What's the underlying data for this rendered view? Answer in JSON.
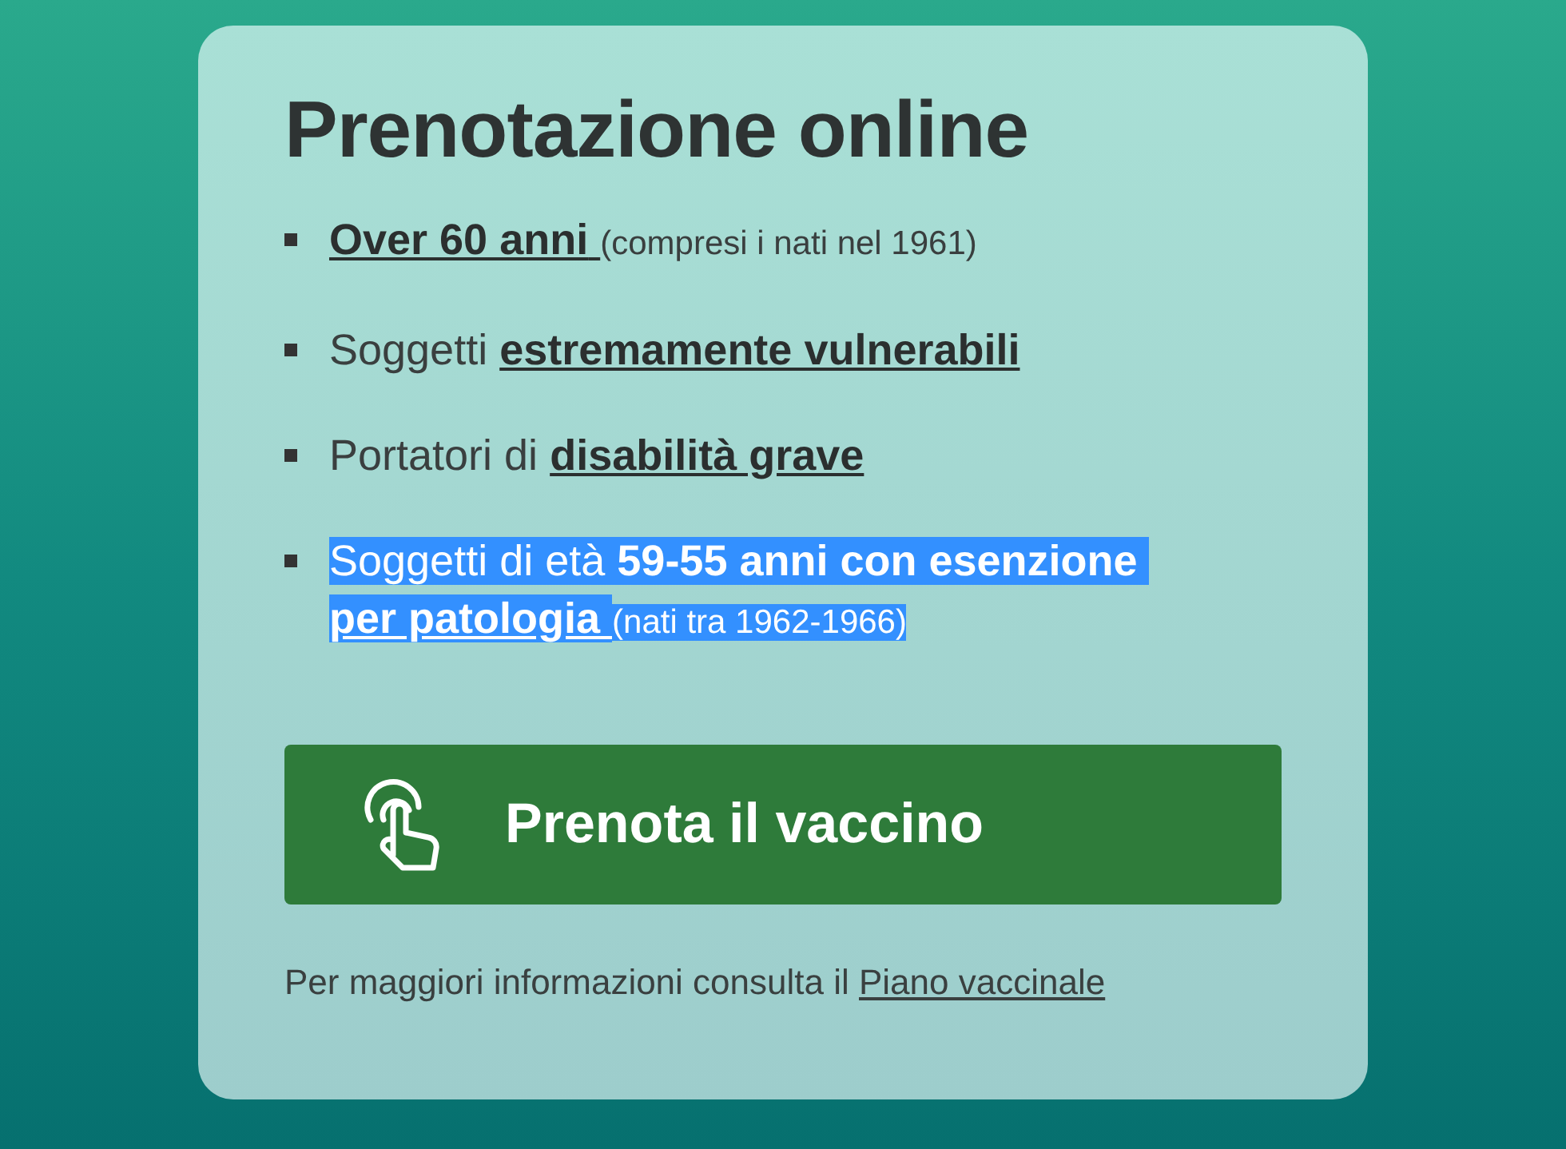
{
  "title": "Prenotazione online",
  "items": [
    {
      "highlighted": false,
      "segments": [
        {
          "kind": "link",
          "text": "Over 60 anni"
        },
        {
          "kind": "note",
          "text": "(compresi i nati nel 1961)"
        }
      ]
    },
    {
      "highlighted": false,
      "segments": [
        {
          "kind": "plain",
          "text": "Soggetti"
        },
        {
          "kind": "link",
          "text": "estremamente vulnerabili"
        }
      ]
    },
    {
      "highlighted": false,
      "segments": [
        {
          "kind": "plain",
          "text": "Portatori di"
        },
        {
          "kind": "link",
          "text": "disabilità grave"
        }
      ]
    },
    {
      "highlighted": true,
      "segments": [
        {
          "kind": "plain",
          "text": "Soggetti di età"
        },
        {
          "kind": "strong",
          "text": "59-55 anni con esenzione"
        },
        {
          "kind": "link",
          "text": "per patologia"
        },
        {
          "kind": "note",
          "text": "(nati tra 1962-1966)"
        }
      ]
    }
  ],
  "button": {
    "label": "Prenota il vaccino"
  },
  "footer": {
    "text": "Per maggiori informazioni consulta il",
    "link": "Piano vaccinale"
  }
}
